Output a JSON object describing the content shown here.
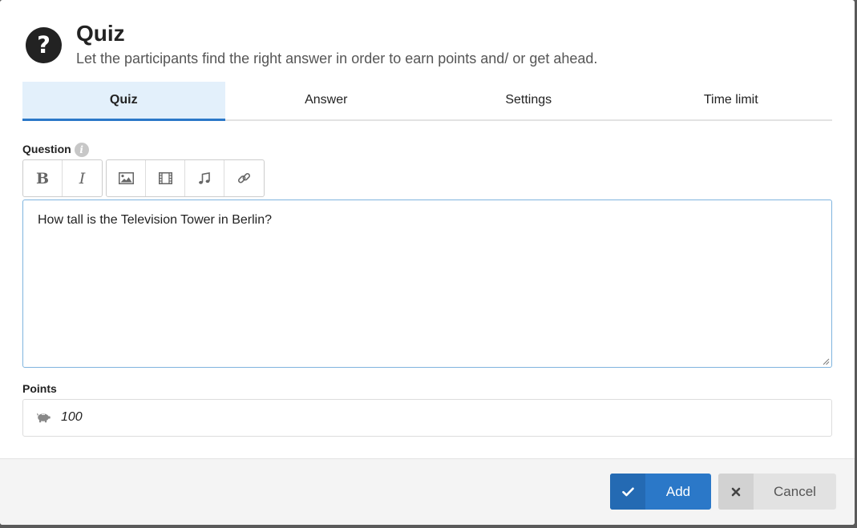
{
  "header": {
    "icon": "question-icon",
    "icon_glyph": "?",
    "title": "Quiz",
    "subtitle": "Let the participants find the right answer in order to earn points and/ or get ahead."
  },
  "tabs": [
    {
      "label": "Quiz",
      "active": true
    },
    {
      "label": "Answer",
      "active": false
    },
    {
      "label": "Settings",
      "active": false
    },
    {
      "label": "Time limit",
      "active": false
    }
  ],
  "question": {
    "label": "Question",
    "info_glyph": "i",
    "toolbar": {
      "bold_glyph": "B",
      "italic_glyph": "I",
      "icons": [
        "bold-icon",
        "italic-icon",
        "image-icon",
        "video-icon",
        "music-icon",
        "link-icon"
      ]
    },
    "value": "How tall is the Television Tower in Berlin?"
  },
  "points": {
    "label": "Points",
    "icon": "piggy-bank-icon",
    "value": "100"
  },
  "footer": {
    "add_label": "Add",
    "cancel_label": "Cancel"
  },
  "colors": {
    "accent": "#2b78c8",
    "tab_active_bg": "#e3f0fb",
    "footer_bg": "#f4f4f4"
  }
}
